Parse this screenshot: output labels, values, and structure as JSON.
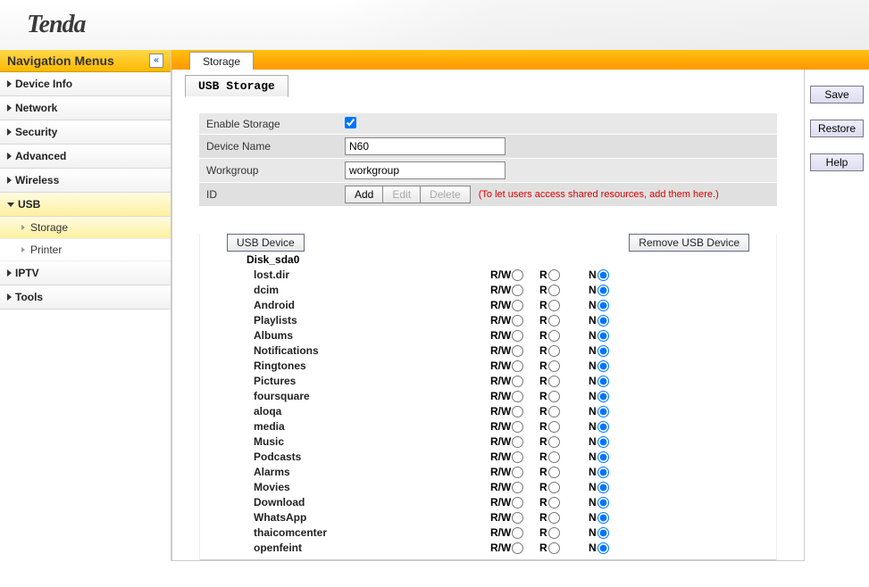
{
  "logo": "Tenda",
  "nav": {
    "title": "Navigation Menus",
    "items": [
      {
        "label": "Device Info"
      },
      {
        "label": "Network"
      },
      {
        "label": "Security"
      },
      {
        "label": "Advanced"
      },
      {
        "label": "Wireless"
      },
      {
        "label": "USB",
        "expanded": true,
        "sub": [
          {
            "label": "Storage",
            "active": true
          },
          {
            "label": "Printer"
          }
        ]
      },
      {
        "label": "IPTV"
      },
      {
        "label": "Tools"
      }
    ]
  },
  "topTab": "Storage",
  "sectionTab": "USB Storage",
  "form": {
    "enableStorage": {
      "label": "Enable Storage",
      "checked": true
    },
    "deviceName": {
      "label": "Device Name",
      "value": "N60"
    },
    "workgroup": {
      "label": "Workgroup",
      "value": "workgroup"
    },
    "id": {
      "label": "ID",
      "add": "Add",
      "edit": "Edit",
      "delete": "Delete",
      "hint": "(To let users access shared resources, add them here.)"
    }
  },
  "usb": {
    "usbDeviceBtn": "USB Device",
    "removeBtn": "Remove USB Device",
    "diskName": "Disk_sda0",
    "permLabels": {
      "rw": "R/W",
      "r": "R",
      "n": "N"
    },
    "folders": [
      {
        "name": "lost.dir",
        "sel": "n"
      },
      {
        "name": "dcim",
        "sel": "n"
      },
      {
        "name": "Android",
        "sel": "n"
      },
      {
        "name": "Playlists",
        "sel": "n"
      },
      {
        "name": "Albums",
        "sel": "n"
      },
      {
        "name": "Notifications",
        "sel": "n"
      },
      {
        "name": "Ringtones",
        "sel": "n"
      },
      {
        "name": "Pictures",
        "sel": "n"
      },
      {
        "name": "foursquare",
        "sel": "n"
      },
      {
        "name": "aloqa",
        "sel": "n"
      },
      {
        "name": "media",
        "sel": "n"
      },
      {
        "name": "Music",
        "sel": "n"
      },
      {
        "name": "Podcasts",
        "sel": "n"
      },
      {
        "name": "Alarms",
        "sel": "n"
      },
      {
        "name": "Movies",
        "sel": "n"
      },
      {
        "name": "Download",
        "sel": "n"
      },
      {
        "name": "WhatsApp",
        "sel": "n"
      },
      {
        "name": "thaicomcenter",
        "sel": "n"
      },
      {
        "name": "openfeint",
        "sel": "n"
      }
    ]
  },
  "actions": {
    "save": "Save",
    "restore": "Restore",
    "help": "Help"
  }
}
